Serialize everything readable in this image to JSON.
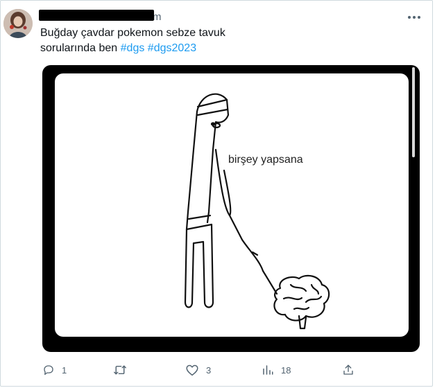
{
  "tweet": {
    "author": {
      "display_name": "",
      "handle": "m",
      "avatar_icon": "avatar-photo"
    },
    "text_line1": "Buğday çavdar pokemon sebze tavuk",
    "text_line2_prefix": "sorularında ben ",
    "hashtags": [
      "#dgs",
      "#dgs2023"
    ],
    "media": {
      "meme_caption": "birşey yapsana"
    },
    "actions": {
      "reply": {
        "icon": "reply-icon",
        "count": "1"
      },
      "retweet": {
        "icon": "retweet-icon",
        "count": ""
      },
      "like": {
        "icon": "heart-icon",
        "count": "3"
      },
      "views": {
        "icon": "views-icon",
        "count": "18"
      },
      "share": {
        "icon": "share-icon",
        "count": ""
      }
    }
  },
  "colors": {
    "accent": "#1d9bf0",
    "muted": "#536471",
    "text": "#0f1419",
    "border": "#cfd9de"
  }
}
